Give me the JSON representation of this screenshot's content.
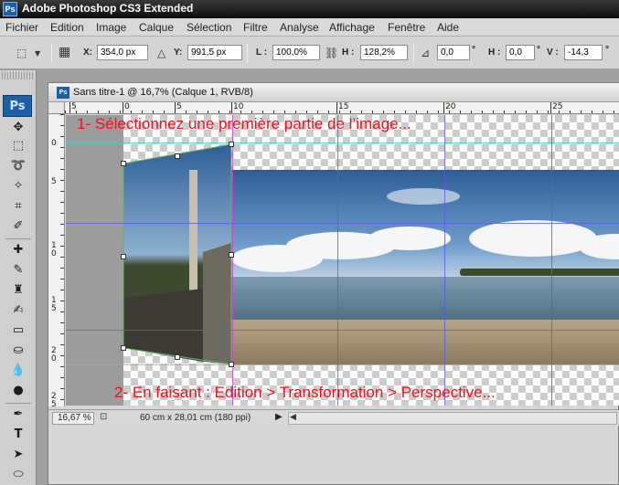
{
  "app": {
    "title": "Adobe Photoshop CS3 Extended",
    "logo_text": "Ps"
  },
  "menu": {
    "items": [
      "Fichier",
      "Edition",
      "Image",
      "Calque",
      "Sélection",
      "Filtre",
      "Analyse",
      "Affichage",
      "Fenêtre",
      "Aide"
    ]
  },
  "options": {
    "x_label": "X:",
    "x_value": "354,0 px",
    "y_label": "Y:",
    "y_value": "991,5 px",
    "w_label": "L :",
    "w_value": "100,0%",
    "h_label": "H :",
    "h_value": "128,2%",
    "angle_value": "0,0",
    "deg1": "°",
    "hskew_label": "H :",
    "hskew_value": "0,0",
    "deg2": "°",
    "vskew_label": "V :",
    "vskew_value": "-14,3",
    "deg3": "°"
  },
  "toolbar": {
    "logo_text": "Ps"
  },
  "document": {
    "title": "Sans titre-1 @ 16,7% (Calque 1, RVB/8)",
    "ruler_top_labels": [
      "5",
      "0",
      "5",
      "10",
      "15",
      "20",
      "25"
    ],
    "ruler_left_labels": [
      "0",
      "5",
      "1\n0",
      "1\n5",
      "2\n0",
      "2\n5"
    ]
  },
  "overlay": {
    "step1": "1- Sélectionnez une première partie de l’image...",
    "step2": "2- En faisant : Edition > Transformation > Perspective..."
  },
  "status": {
    "zoom": "16,67 %",
    "doc_size": "60 cm x 28,01 cm (180 ppi)"
  },
  "colors": {
    "overlay_text": "#e8141e",
    "guides": "#5a5ae6",
    "title_bar": "#0c0c0c",
    "photoshop_blue": "#1c5fa8"
  }
}
